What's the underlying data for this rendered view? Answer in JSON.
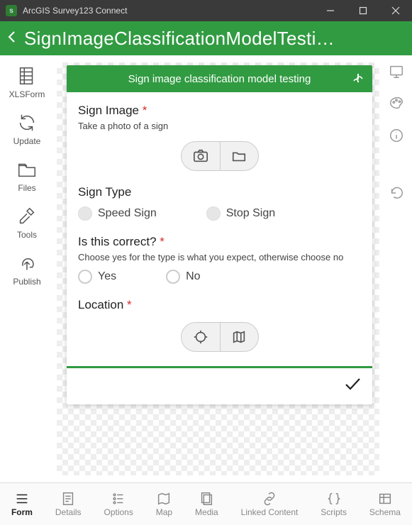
{
  "window": {
    "title": "ArcGIS Survey123 Connect"
  },
  "header": {
    "title": "SignImageClassificationModelTesti…"
  },
  "leftSidebar": {
    "items": [
      {
        "label": "XLSForm"
      },
      {
        "label": "Update"
      },
      {
        "label": "Files"
      },
      {
        "label": "Tools"
      },
      {
        "label": "Publish"
      }
    ]
  },
  "form": {
    "title": "Sign image classification model testing",
    "q1": {
      "label": "Sign Image",
      "required": "*",
      "hint": "Take a photo of a sign"
    },
    "q2": {
      "label": "Sign Type",
      "opt1": "Speed Sign",
      "opt2": "Stop Sign"
    },
    "q3": {
      "label": "Is this correct?",
      "required": "*",
      "hint": "Choose yes for the type is what you expect, otherwise choose no",
      "opt1": "Yes",
      "opt2": "No"
    },
    "q4": {
      "label": "Location",
      "required": "*"
    }
  },
  "bottomTabs": {
    "items": [
      {
        "label": "Form"
      },
      {
        "label": "Details"
      },
      {
        "label": "Options"
      },
      {
        "label": "Map"
      },
      {
        "label": "Media"
      },
      {
        "label": "Linked Content"
      },
      {
        "label": "Scripts"
      },
      {
        "label": "Schema"
      }
    ]
  }
}
